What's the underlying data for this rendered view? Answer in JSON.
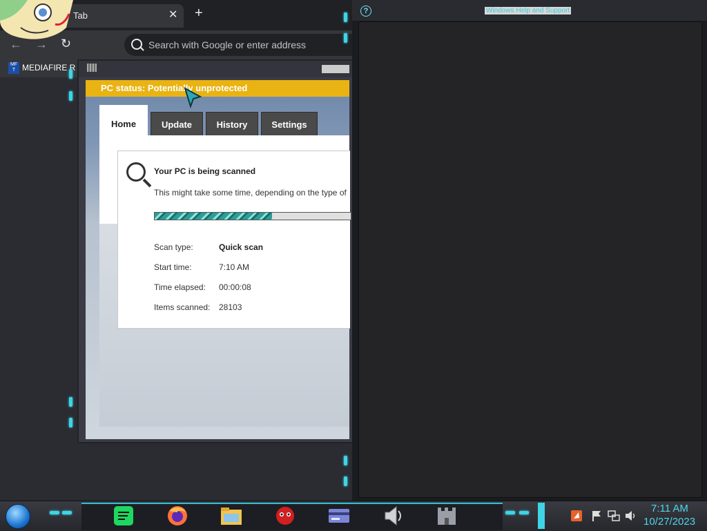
{
  "browser": {
    "tab_title": "Tab",
    "tab_close": "✕",
    "new_tab": "+",
    "back": "←",
    "forward": "→",
    "reload": "↻",
    "omnibox_placeholder": "Search with Google or enter address",
    "bookmark_label": "MEDIAFIRE R",
    "bookmark_icon_text": "MF T"
  },
  "defender": {
    "status_text": "PC status: Potentially unprotected",
    "status_color": "#e9b313",
    "tabs": [
      "Home",
      "Update",
      "History",
      "Settings"
    ],
    "scan_title": "Your PC is being scanned",
    "scan_desc": "This might take some time, depending on the type of",
    "progress": 0.6,
    "details": [
      {
        "label": "Scan type:",
        "value": "Quick scan"
      },
      {
        "label": "Start time:",
        "value": "7:10 AM"
      },
      {
        "label": "Time elapsed:",
        "value": "00:00:08"
      },
      {
        "label": "Items scanned:",
        "value": "28103"
      }
    ]
  },
  "help": {
    "title": "Windows Help and Support",
    "icon": "?"
  },
  "taskbar": {
    "apps": [
      "spotify-icon",
      "firefox-icon",
      "file-explorer-icon",
      "red-mascot-icon",
      "card-icon",
      "speaker-app-icon",
      "castle-icon"
    ],
    "clock_time": "7:11 AM",
    "clock_date": "10/27/2023",
    "accent_color": "#3fd4e6"
  }
}
